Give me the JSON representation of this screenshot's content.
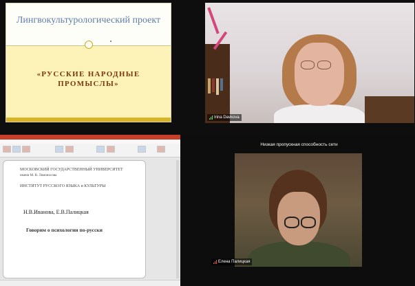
{
  "slide_top": {
    "title": "Лингвокультурологический проект",
    "subtitle": "«РУССКИЕ НАРОДНЫЕ ПРОМЫСЛЫ»"
  },
  "participants": {
    "irina": {
      "name": "Irina Davkova"
    },
    "elena": {
      "name": "Елена Палицкая",
      "notice": "Низкая пропускная способность сети"
    }
  },
  "ppt_slide": {
    "university_line1": "МОСКОВСКИЙ ГОСУДАРСТВЕННЫЙ УНИВЕРСИТЕТ",
    "university_line2": "имени М. В. Ломоносова",
    "institute": "ИНСТИТУТ РУССКОГО ЯЗЫКА и КУЛЬТУРЫ",
    "authors": "Н.В.Иванова, Е.В.Палицкая",
    "book_title": "Говорим о психологии по-русски"
  },
  "colors": {
    "slide_title": "#5d7caa",
    "slide_subtitle": "#7a3811",
    "slide_band": "#fdf3b9",
    "ppt_titlebar": "#c5402a"
  }
}
